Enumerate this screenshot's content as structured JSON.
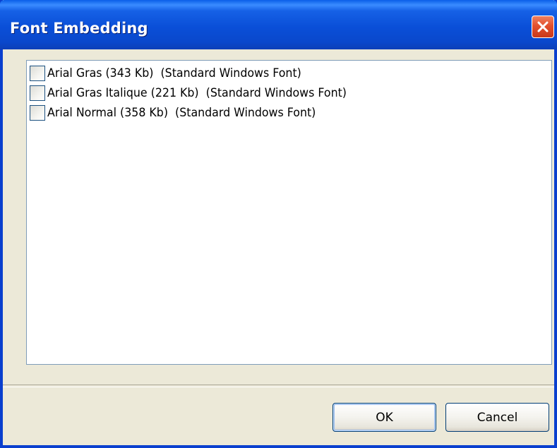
{
  "window": {
    "title": "Font Embedding",
    "close_icon": "close-x-icon"
  },
  "font_list": {
    "items": [
      {
        "label": "Arial Gras (343 Kb)  (Standard Windows Font)",
        "checked": false
      },
      {
        "label": "Arial Gras Italique (221 Kb)  (Standard Windows Font)",
        "checked": false
      },
      {
        "label": "Arial Normal (358 Kb)  (Standard Windows Font)",
        "checked": false
      }
    ]
  },
  "buttons": {
    "ok_label": "OK",
    "cancel_label": "Cancel"
  },
  "colors": {
    "titlebar": "#0a4fd8",
    "dialog_background": "#ece9d8",
    "close_button": "#e2502e",
    "list_border": "#7f9db9"
  }
}
